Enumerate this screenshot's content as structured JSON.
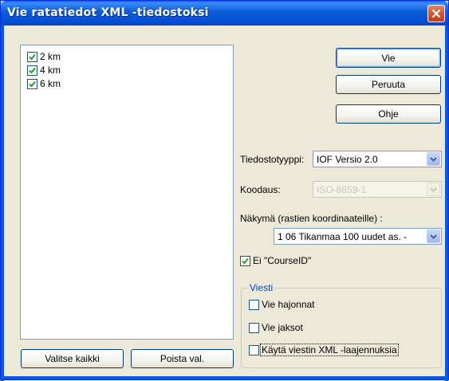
{
  "window": {
    "title": "Vie ratatiedot XML -tiedostoksi"
  },
  "courses": [
    {
      "label": "2 km",
      "checked": true
    },
    {
      "label": "4 km",
      "checked": true
    },
    {
      "label": "6 km",
      "checked": true
    }
  ],
  "buttons": {
    "export": "Vie",
    "cancel": "Peruuta",
    "help": "Ohje",
    "select_all": "Valitse kaikki",
    "deselect": "Poista val."
  },
  "file_type": {
    "label": "Tiedostotyyppi:",
    "value": "IOF Versio 2.0"
  },
  "encoding": {
    "label": "Koodaus:",
    "value": "ISO-8859-1",
    "enabled": false
  },
  "view": {
    "label": "Näkymä (rastien koordinaateille) :",
    "value": "1 06 Tikanmaa 100 uudet as. -"
  },
  "no_course_id": {
    "label": "Ei \"CourseID\"",
    "checked": true
  },
  "relay": {
    "group_title": "Viesti",
    "options": [
      {
        "label": "Vie hajonnat",
        "checked": false
      },
      {
        "label": "Vie jaksot",
        "checked": false
      },
      {
        "label": "Käytä viestin XML -laajennuksia",
        "checked": false
      }
    ]
  },
  "colors": {
    "title_bar": "#0a5fe8",
    "window_bg": "#ece9d8",
    "close_button": "#d6572f",
    "group_title": "#0046d5",
    "checkmark": "#21a121"
  }
}
